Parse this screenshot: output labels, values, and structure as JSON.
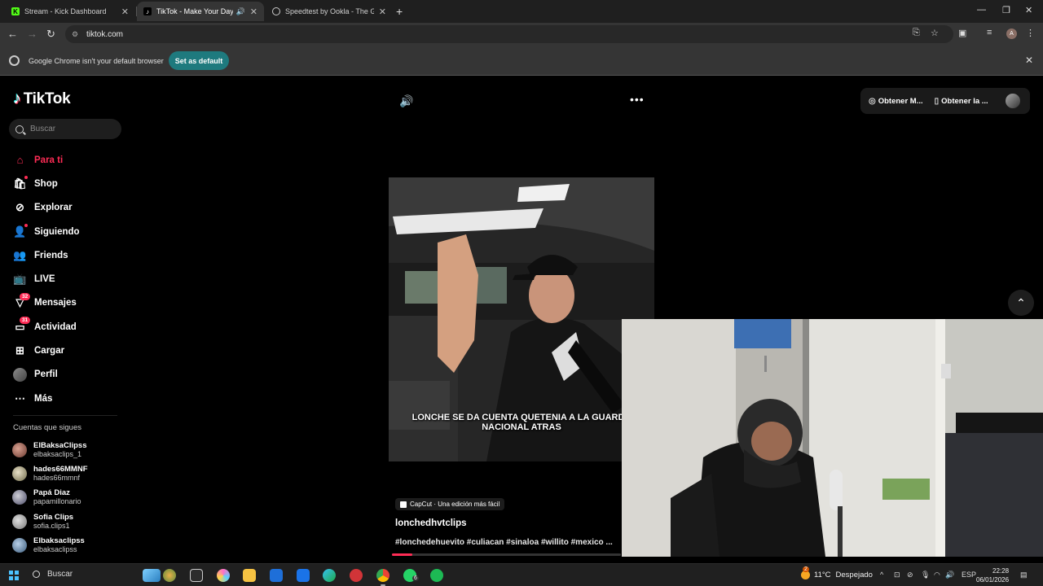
{
  "browser": {
    "tabs": [
      {
        "title": "Stream - Kick Dashboard",
        "favicon": "kick-icon",
        "active": false
      },
      {
        "title": "TikTok - Make Your Day",
        "favicon": "tiktok-icon",
        "active": true
      },
      {
        "title": "Speedtest by Ookla - The Glob...",
        "favicon": "speedtest-icon",
        "active": false
      }
    ],
    "url": "tiktok.com",
    "profile_initial": "A",
    "infobar": {
      "message": "Google Chrome isn't your default browser",
      "button": "Set as default"
    }
  },
  "tiktok": {
    "logo_text": "TikTok",
    "search_placeholder": "Buscar",
    "menu": [
      {
        "label": "Para ti",
        "icon": "home-icon",
        "active": true
      },
      {
        "label": "Shop",
        "icon": "shop-icon"
      },
      {
        "label": "Explorar",
        "icon": "compass-icon"
      },
      {
        "label": "Siguiendo",
        "icon": "following-icon"
      },
      {
        "label": "Friends",
        "icon": "friends-icon"
      },
      {
        "label": "LIVE",
        "icon": "live-icon"
      },
      {
        "label": "Mensajes",
        "icon": "messages-icon",
        "badge": "32"
      },
      {
        "label": "Actividad",
        "icon": "activity-icon",
        "badge": "31"
      },
      {
        "label": "Cargar",
        "icon": "upload-icon"
      },
      {
        "label": "Perfil",
        "icon": "profile-avatar"
      },
      {
        "label": "Más",
        "icon": "more-icon"
      }
    ],
    "following_title": "Cuentas que sigues",
    "following": [
      {
        "name": "ElBaksaClipss",
        "handle": "elbaksaclips_1"
      },
      {
        "name": "hades66MMNF",
        "handle": "hades66mmnf"
      },
      {
        "name": "Papá Diaz",
        "handle": "papamillonario"
      },
      {
        "name": "Sofia Clips",
        "handle": "sofia.clips1"
      },
      {
        "name": "Elbaksaclipss",
        "handle": "elbaksaclipss"
      }
    ],
    "top_buttons": [
      {
        "label": "Obtener M...",
        "icon": "coin-icon"
      },
      {
        "label": "Obtener la ...",
        "icon": "phone-icon"
      }
    ],
    "video": {
      "caption": "LONCHE SE DA CUENTA QUETENIA A LA GUARDA NACIONAL ATRAS",
      "capcut": "CapCut · Una edición más fácil",
      "username": "lonchedhvtclips",
      "hashtags": "#lonchedehuevito #culiacan #sinaloa #willito #mexico ...",
      "progress": 0.09
    }
  },
  "taskbar": {
    "search_label": "Buscar",
    "whatsapp_badge": "6",
    "weather_temp": "11°C",
    "weather_desc": "Despejado",
    "weather_badge": "2",
    "lang": "ESP",
    "time": "22:28",
    "date": "06/01/2026"
  }
}
